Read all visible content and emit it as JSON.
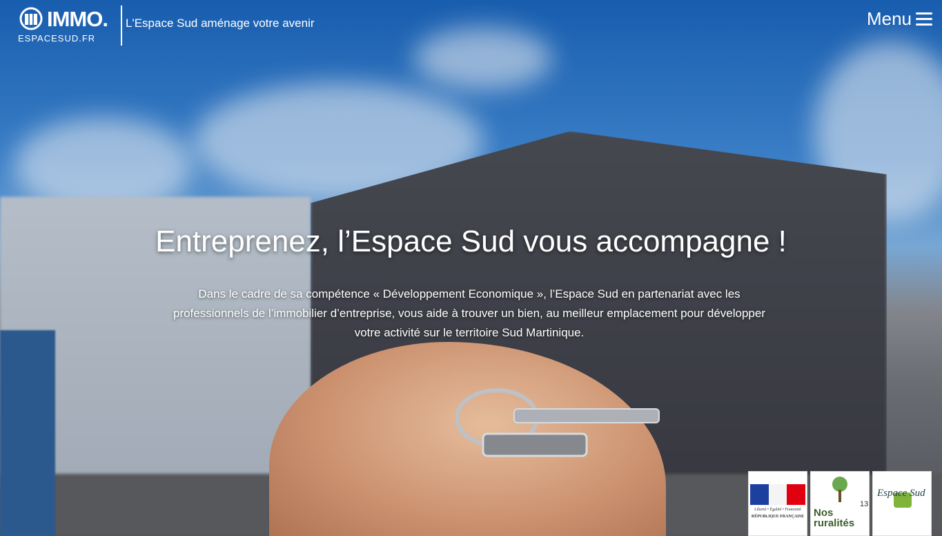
{
  "header": {
    "logo_word": "IMMO.",
    "logo_sub": "ESPACESUD.FR",
    "tagline": "L'Espace Sud aménage votre avenir",
    "menu_label": "Menu"
  },
  "hero": {
    "title": "Entreprenez, l’Espace Sud vous accompagne !",
    "description": "Dans le cadre de sa compétence « Développement Economique », l’Espace Sud en partenariat avec les professionnels de l’immobilier d’entreprise, vous aide à trouver un bien, au meilleur emplacement pour développer votre activité sur le territoire Sud Martinique."
  },
  "partners": [
    {
      "name": "republique-francaise",
      "motto": "Liberté • Égalité • Fraternité",
      "label": "RÉPUBLIQUE FRANÇAISE"
    },
    {
      "name": "nos-ruralites",
      "label": "Nos ruralités"
    },
    {
      "name": "espace-sud",
      "label": "Espace Sud"
    }
  ],
  "page_indicator": "13",
  "colors": {
    "flag_blue": "#1d3f9e",
    "flag_red": "#e1000f",
    "accent_green": "#7fb33a"
  }
}
